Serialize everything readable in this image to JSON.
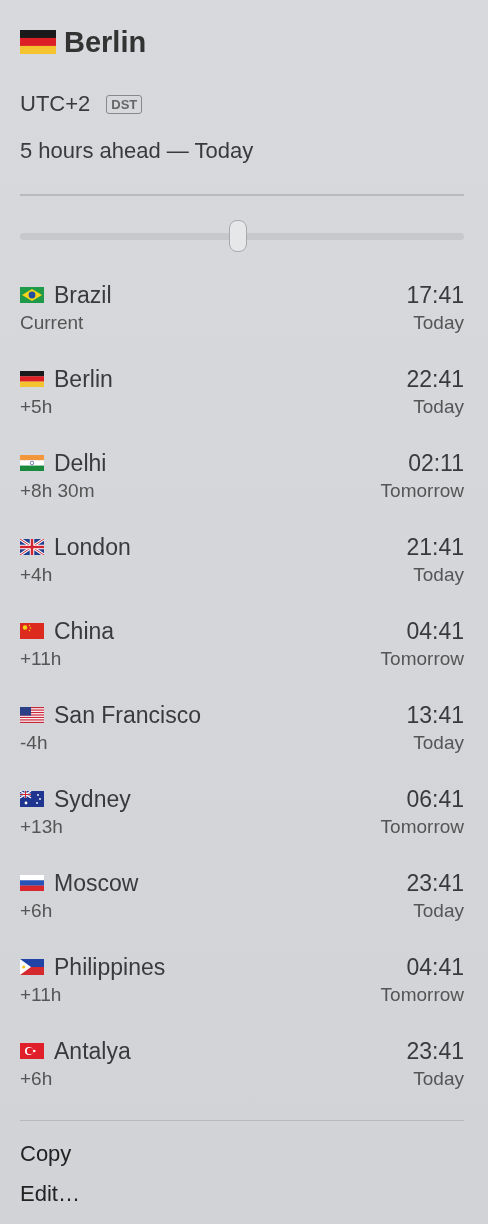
{
  "header": {
    "kind": "de",
    "city": "Berlin",
    "offset": "UTC+2",
    "badge": "DST",
    "relative": "5 hours ahead — Today"
  },
  "slider": {
    "level": 0.49
  },
  "zones": [
    {
      "kind": "br",
      "name": "Brazil",
      "diff": "Current",
      "time": "17:41",
      "day": "Today"
    },
    {
      "kind": "de",
      "name": "Berlin",
      "diff": "+5h",
      "time": "22:41",
      "day": "Today"
    },
    {
      "kind": "in",
      "name": "Delhi",
      "diff": "+8h 30m",
      "time": "02:11",
      "day": "Tomorrow"
    },
    {
      "kind": "gb",
      "name": "London",
      "diff": "+4h",
      "time": "21:41",
      "day": "Today"
    },
    {
      "kind": "cn",
      "name": "China",
      "diff": "+11h",
      "time": "04:41",
      "day": "Tomorrow"
    },
    {
      "kind": "us",
      "name": "San Francisco",
      "diff": "-4h",
      "time": "13:41",
      "day": "Today"
    },
    {
      "kind": "au",
      "name": "Sydney",
      "diff": "+13h",
      "time": "06:41",
      "day": "Tomorrow"
    },
    {
      "kind": "ru",
      "name": "Moscow",
      "diff": "+6h",
      "time": "23:41",
      "day": "Today"
    },
    {
      "kind": "ph",
      "name": "Philippines",
      "diff": "+11h",
      "time": "04:41",
      "day": "Tomorrow"
    },
    {
      "kind": "tr",
      "name": "Antalya",
      "diff": "+6h",
      "time": "23:41",
      "day": "Today"
    }
  ],
  "menu": [
    "Copy",
    "Edit…"
  ]
}
